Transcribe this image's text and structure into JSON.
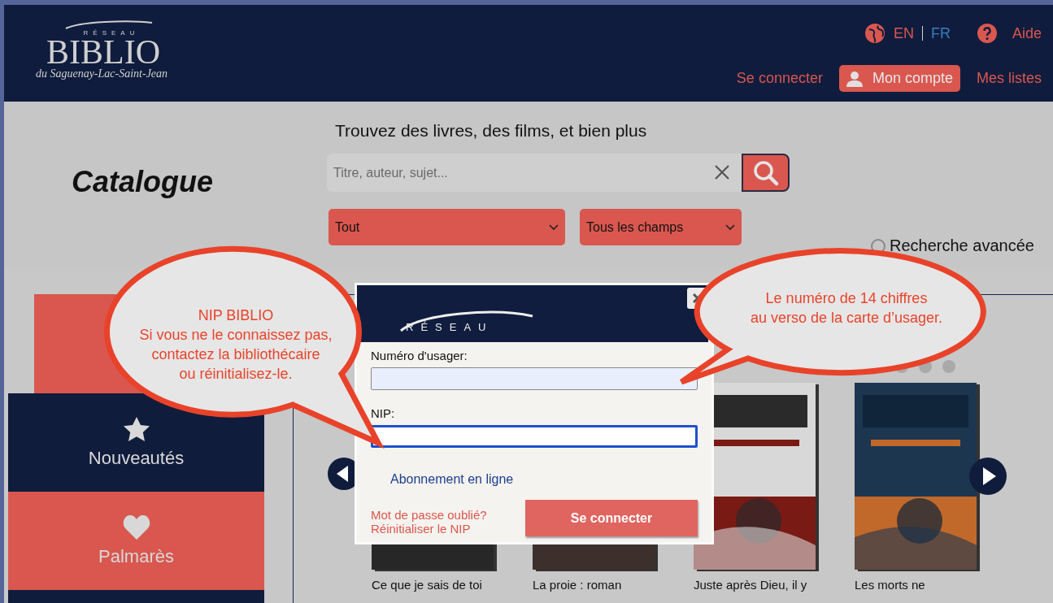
{
  "header": {
    "logo": {
      "top": "RÉSEAU",
      "name": "BIBLIO",
      "region": "du Saguenay-Lac-Saint-Jean"
    },
    "languages": [
      {
        "label": "EN",
        "selected": false
      },
      {
        "label": "FR",
        "selected": true
      }
    ],
    "help": "Aide",
    "nav": [
      {
        "label": "Se connecter",
        "kind": "link"
      },
      {
        "label": "Mon compte",
        "kind": "account"
      },
      {
        "label": "Mes listes",
        "kind": "link"
      }
    ]
  },
  "search": {
    "section_title": "Catalogue",
    "heading": "Trouvez des livres, des films, et bien plus",
    "placeholder": "Titre, auteur, sujet...",
    "selects": [
      "Tout",
      "Tous les champs"
    ],
    "advanced": "Recherche avancée"
  },
  "sidebar": [
    {
      "kind": "plain",
      "color": "#d9574f"
    },
    {
      "kind": "star",
      "label": "Nouveautés",
      "color": "#101c3c"
    },
    {
      "kind": "heart",
      "label": "Palmarès",
      "color": "#d9574f"
    },
    {
      "kind": "plain",
      "color": "#101c3c"
    }
  ],
  "carousel": {
    "books": [
      {
        "title": "Ce que je sais de toi"
      },
      {
        "title": "La proie : roman"
      },
      {
        "title": "Juste après Dieu, il y"
      },
      {
        "title": "Les morts ne"
      }
    ]
  },
  "login_dialog": {
    "logo_top": "RÉSEAU",
    "fields": [
      {
        "label": "Numéro d'usager:",
        "focused": false
      },
      {
        "label": "NIP:",
        "focused": true
      }
    ],
    "signup_link": "Abonnement en ligne",
    "help_links": [
      "Mot de passe oublié?",
      "Réinitialiser le NIP"
    ],
    "submit": "Se connecter"
  },
  "callouts": [
    {
      "text": "NIP BIBLIO\nSi vous ne le connaissez pas,\ncontactez la bibliothécaire\nou réinitialisez-le."
    },
    {
      "text": "Le numéro de 14 chiffres\nau verso de la carte d’usager."
    }
  ]
}
